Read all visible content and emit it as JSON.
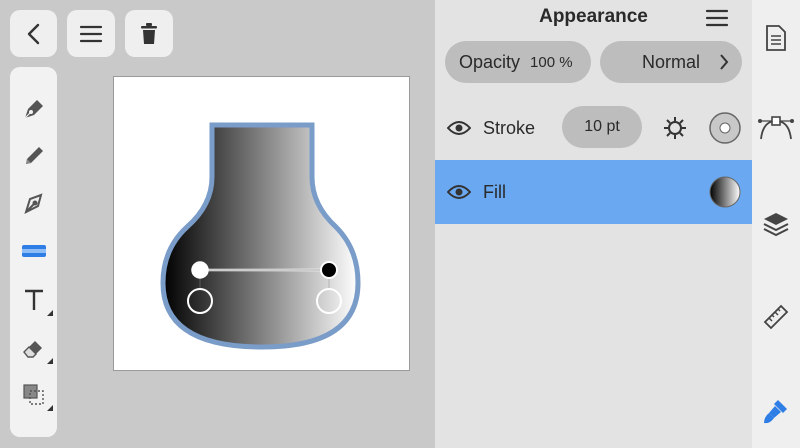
{
  "panel": {
    "title": "Appearance",
    "opacity_label": "Opacity",
    "opacity_value": "100 %",
    "blend_mode": "Normal",
    "stroke": {
      "label": "Stroke",
      "width": "10 pt"
    },
    "fill": {
      "label": "Fill"
    }
  },
  "colors": {
    "accent": "#6aa8f2",
    "tool_active": "#2f7ee6",
    "panel_bg": "#e3e3e3",
    "canvas_bg": "#c9c9c9",
    "stroke_outline": "#7a9cc8"
  },
  "icons": {
    "top": [
      "back-icon",
      "menu-icon",
      "trash-icon"
    ],
    "tools": [
      "pen-icon",
      "pencil-icon",
      "node-icon",
      "shape-tool-icon",
      "text-icon",
      "eraser-icon",
      "transform-icon"
    ],
    "sidebar": [
      "document-icon",
      "path-icon",
      "layers-icon",
      "ruler-icon",
      "brush-icon"
    ]
  }
}
